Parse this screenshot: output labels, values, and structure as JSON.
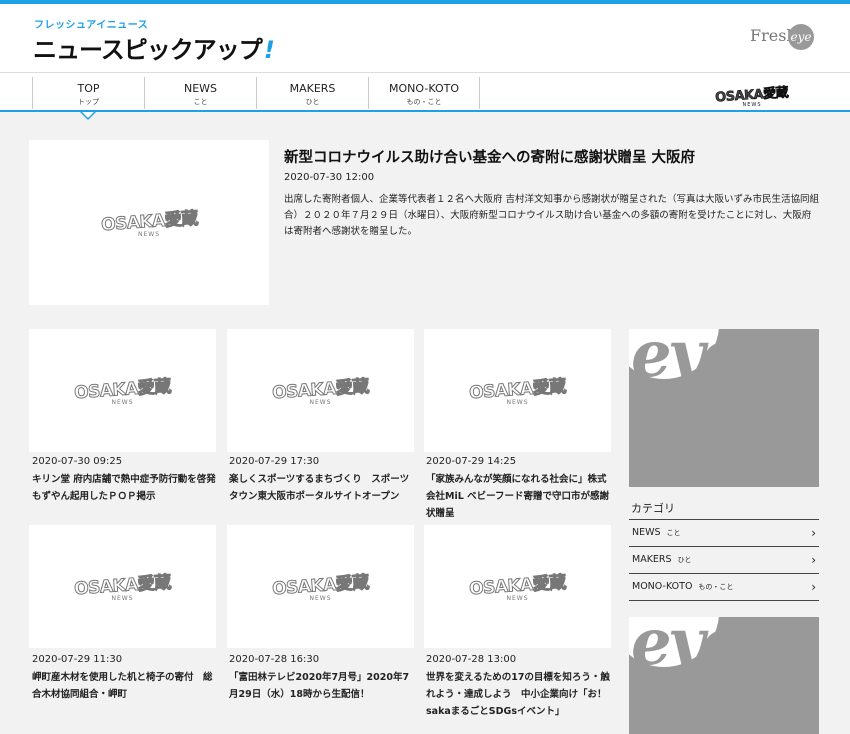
{
  "header": {
    "logo_small": "フレッシュアイニュース",
    "logo_main": "ニュースピックアップ",
    "logo_bang": "!",
    "fresheye_text": "Fresh",
    "fresheye_circle": "eye"
  },
  "nav": {
    "items": [
      {
        "en": "TOP",
        "jp": "トップ"
      },
      {
        "en": "NEWS",
        "jp": "こと"
      },
      {
        "en": "MAKERS",
        "jp": "ひと"
      },
      {
        "en": "MONO-KOTO",
        "jp": "もの・こと"
      }
    ],
    "brand": "OSAKA愛蔵",
    "brand_sub": "NEWS"
  },
  "thumb_logo": {
    "word": "OSAKA愛蔵",
    "sub": "NEWS"
  },
  "featured": {
    "title": "新型コロナウイルス助け合い基金への寄附に感謝状贈呈 大阪府",
    "date": "2020-07-30 12:00",
    "body": "出席した寄附者個人、企業等代表者１２名へ大阪府 吉村洋文知事から感謝状が贈呈された（写真は大阪いずみ市民生活協同組合）２０２０年７月２９日（水曜日）、大阪府新型コロナウイルス助け合い基金への多額の寄附を受けたことに対し、大阪府は寄附者へ感謝状を贈呈した。"
  },
  "cards": [
    {
      "date": "2020-07-30 09:25",
      "title": "キリン堂 府内店舗で熱中症予防行動を啓発 もずやん起用したＰＯＰ掲示"
    },
    {
      "date": "2020-07-29 17:30",
      "title": "楽しくスポーツするまちづくり　スポーツタウン東大阪市ポータルサイトオープン"
    },
    {
      "date": "2020-07-29 14:25",
      "title": "「家族みんなが笑顔になれる社会に」株式会社MiL ベビーフード寄贈で守口市が感謝状贈呈"
    },
    {
      "date": "2020-07-29 11:30",
      "title": "岬町産木材を使用した机と椅子の寄付　総合木材協同組合・岬町"
    },
    {
      "date": "2020-07-28 16:30",
      "title": "「富田林テレビ2020年7月号」2020年7月29日（水）18時から生配信！"
    },
    {
      "date": "2020-07-28 13:00",
      "title": "世界を変えるための17の目標を知ろう・触れよう・達成しよう　中小企業向け「お！sakaまるごとSDGsイベント」"
    }
  ],
  "sidebar": {
    "ad_text": "eye",
    "category_title": "カテゴリ",
    "categories": [
      {
        "en": "NEWS",
        "jp": "こと"
      },
      {
        "en": "MAKERS",
        "jp": "ひと"
      },
      {
        "en": "MONO-KOTO",
        "jp": "もの・こと"
      }
    ],
    "chevron": "›"
  },
  "colors": {
    "accent": "#1ea0e6",
    "background": "#f2f2f2",
    "ad_gray": "#999999"
  }
}
